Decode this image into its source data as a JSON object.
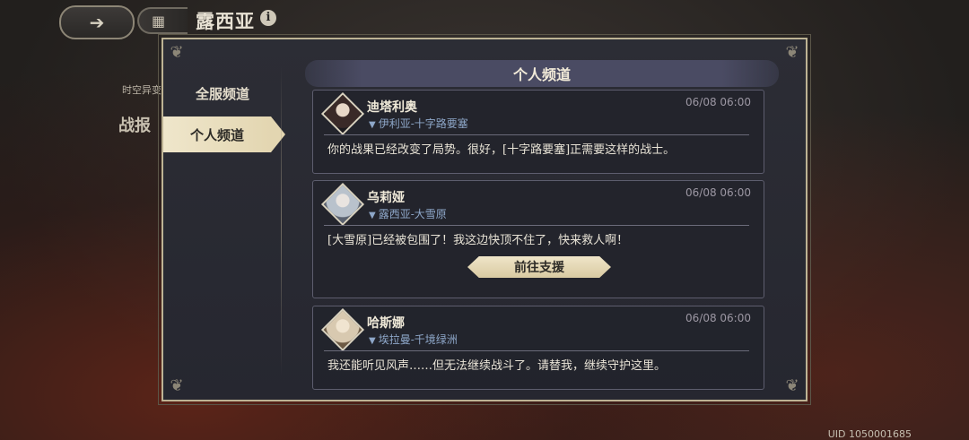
{
  "topbar": {
    "back_icon": "back-arrow-icon",
    "menu_icon": "grid-menu-icon",
    "region_title": "露西亚",
    "info_icon_glyph": "i"
  },
  "background": {
    "left_label": "时空异变",
    "battle_label": "战报",
    "uid_label": "UID 1050001685"
  },
  "sidebar": {
    "tabs": [
      {
        "label": "全服频道",
        "active": false
      },
      {
        "label": "个人频道",
        "active": true
      }
    ]
  },
  "channel": {
    "title": "个人频道",
    "messages": [
      {
        "sender": "迪塔利奥",
        "location": "伊利亚-十字路要塞",
        "time": "06/08 06:00",
        "text": "你的战果已经改变了局势。很好，[十字路要塞]正需要这样的战士。",
        "button": null
      },
      {
        "sender": "乌莉娅",
        "location": "露西亚-大雪原",
        "time": "06/08 06:00",
        "text": "[大雪原]已经被包围了！我这边快顶不住了，快来救人啊！",
        "button": "前往支援"
      },
      {
        "sender": "哈斯娜",
        "location": "埃拉曼-千境绿洲",
        "time": "06/08 06:00",
        "text": "我还能听见风声……但无法继续战斗了。请替我，继续守护这里。",
        "button": null
      }
    ]
  },
  "colors": {
    "panel_border": "#bdb394",
    "active_tab": "#e3d6b1",
    "location_text": "#8ea7c9"
  }
}
